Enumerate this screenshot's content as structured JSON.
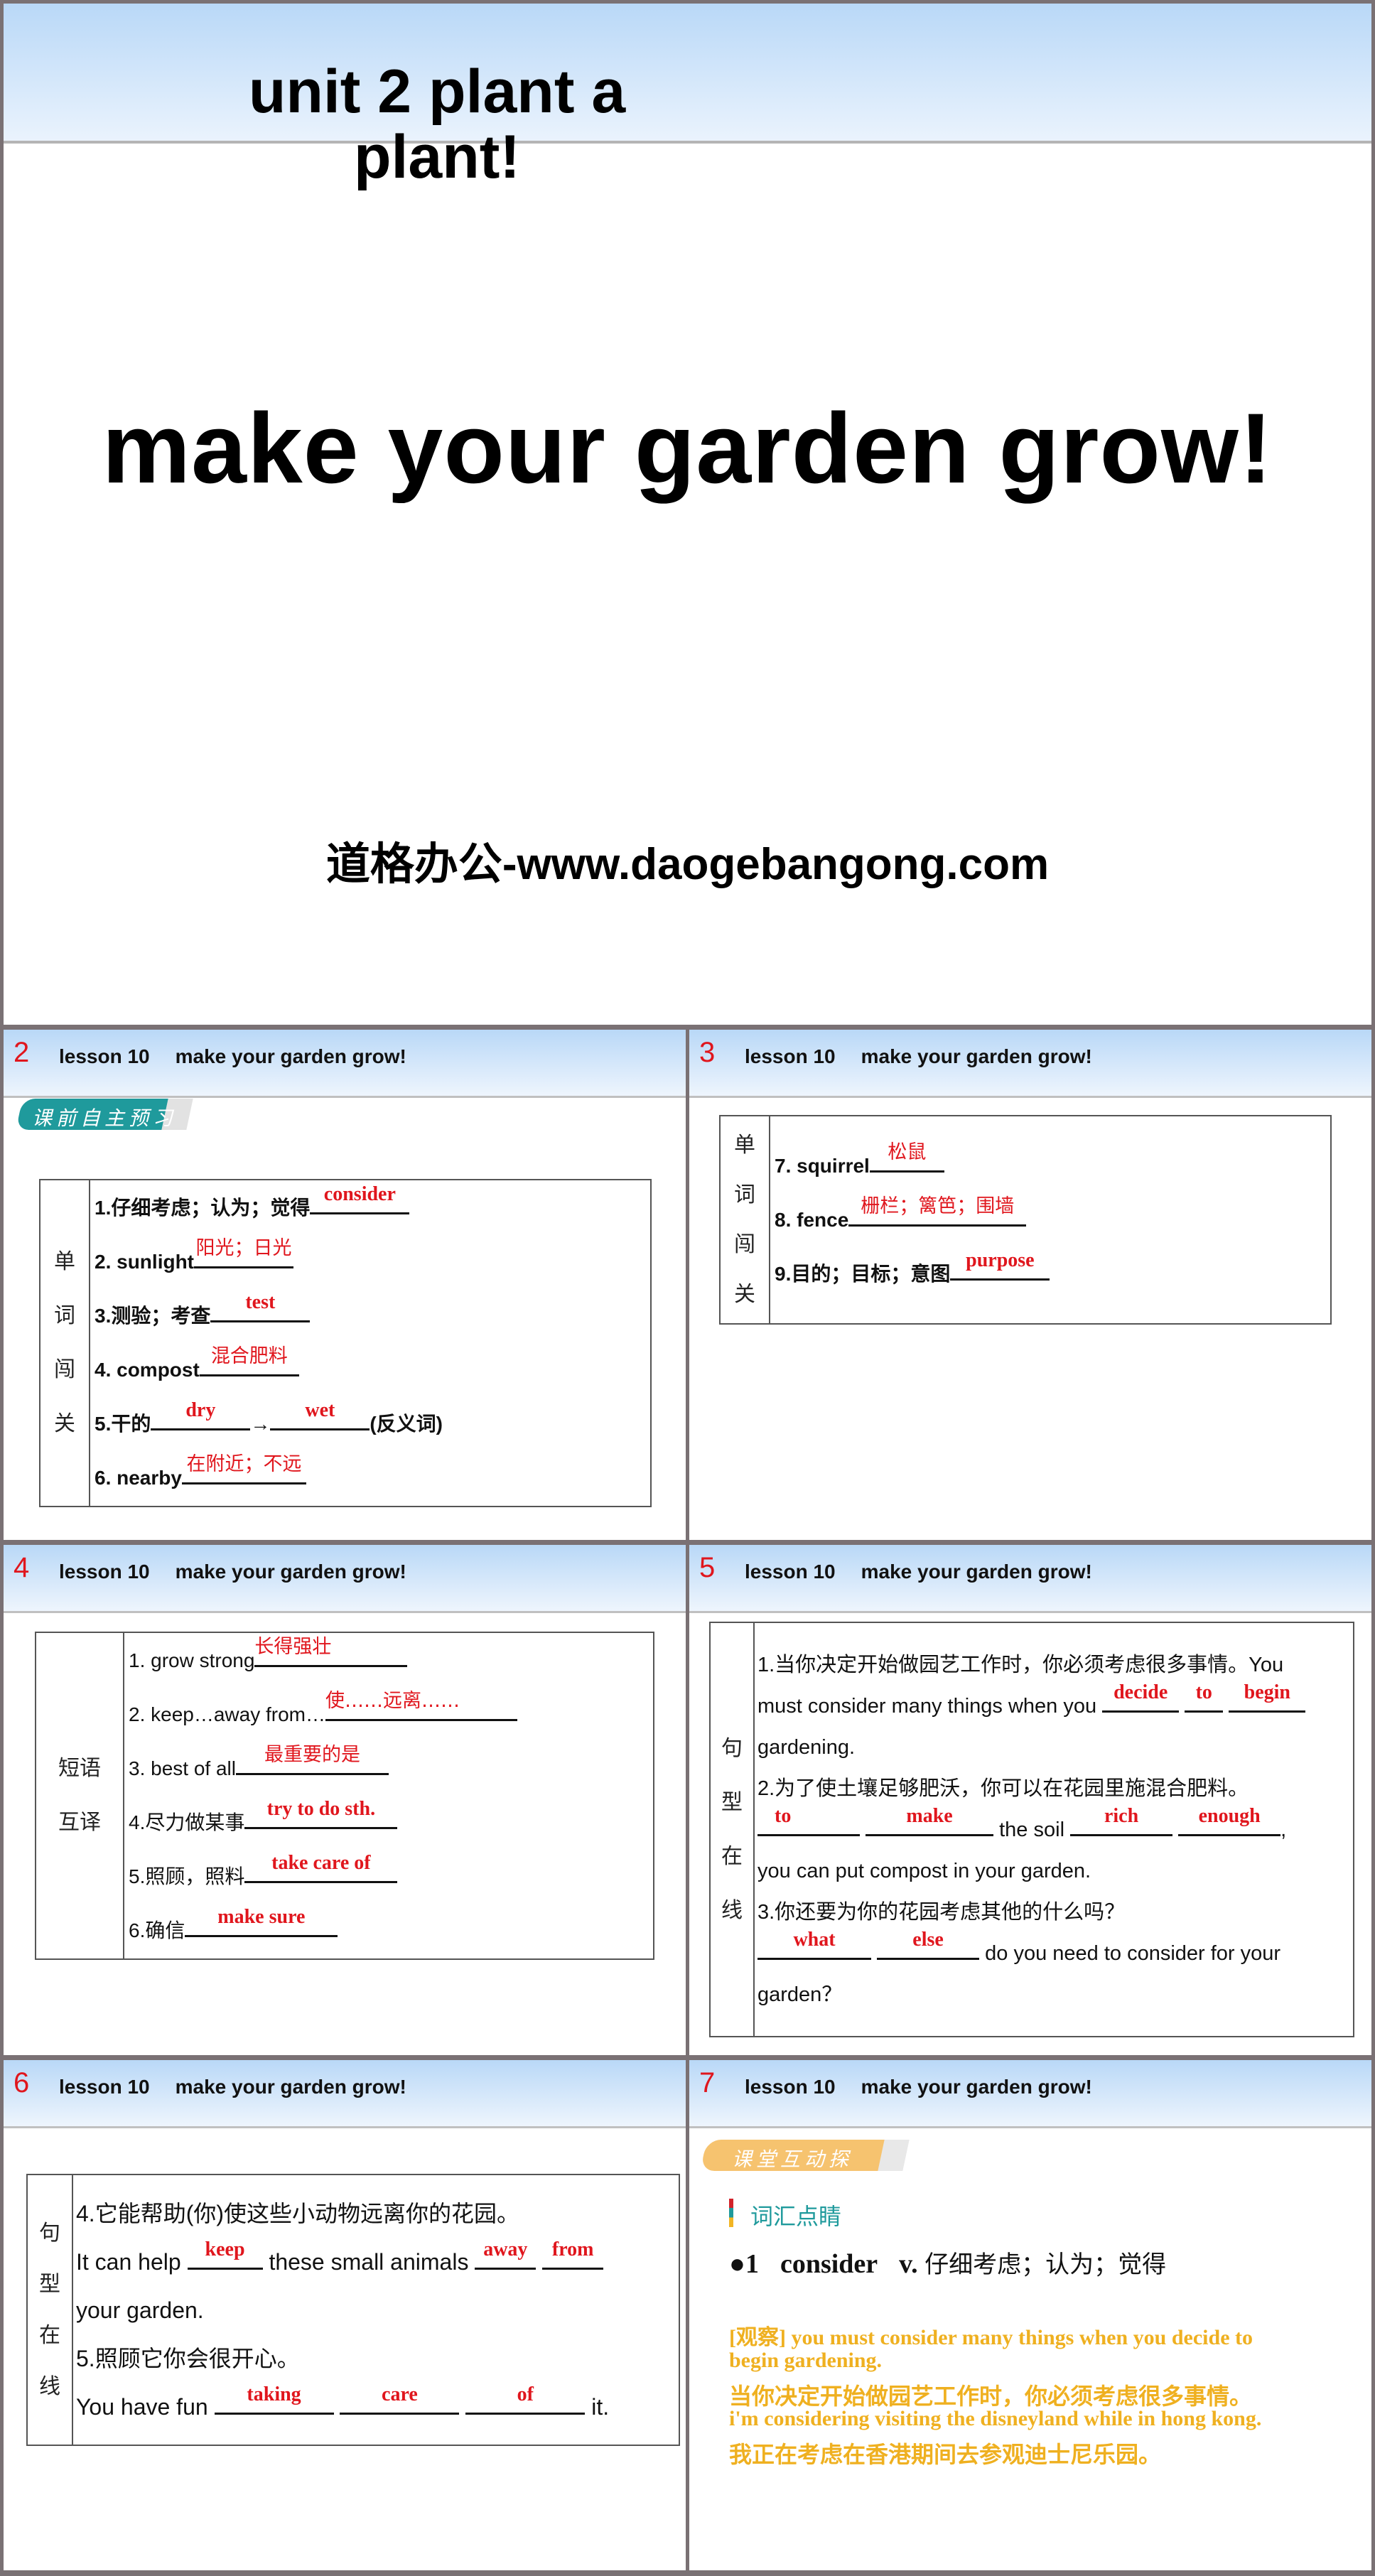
{
  "slide1": {
    "unit_title": "unit 2  plant a plant!",
    "main_title": "make your garden grow!",
    "watermark": "道格办公-www.daogebangong.com"
  },
  "header": {
    "lesson": "lesson 10",
    "title": "make your garden grow!"
  },
  "colors": {
    "answer": "#e0161d",
    "teal": "#1f9a9c",
    "orange": "#efb020",
    "border": "#7a7174"
  },
  "slide2": {
    "number": "2",
    "tag": "课前自主预习",
    "side_label": [
      "单",
      "词",
      "闯",
      "关"
    ],
    "items": [
      {
        "prefix": "1.仔细考虑；认为；觉得",
        "answer": "consider"
      },
      {
        "prefix": "2. sunlight",
        "answer": "阳光；日光"
      },
      {
        "prefix": "3.测验；考查",
        "answer": "test"
      },
      {
        "prefix": "4. compost",
        "answer": "混合肥料"
      },
      {
        "prefix": "5.干的",
        "answer": "dry",
        "arrow": "→",
        "answer2": "wet",
        "suffix": "(反义词)"
      },
      {
        "prefix": "6. nearby",
        "answer": "在附近；不远"
      }
    ]
  },
  "slide3": {
    "number": "3",
    "side_label": [
      "单",
      "词",
      "闯",
      "关"
    ],
    "items": [
      {
        "prefix": "7. squirrel",
        "answer": "松鼠"
      },
      {
        "prefix": "8. fence",
        "answer": "栅栏；篱笆；围墙"
      },
      {
        "prefix": "9.目的；目标；意图",
        "answer": "purpose"
      }
    ]
  },
  "slide4": {
    "number": "4",
    "side_label": [
      "短语",
      "互译"
    ],
    "items": [
      {
        "prefix": "1.   grow strong",
        "answer": "长得强壮"
      },
      {
        "prefix": "2.   keep…away from…",
        "answer": "使……远离……"
      },
      {
        "prefix": "3. best of all",
        "answer": "最重要的是"
      },
      {
        "prefix": "4.尽力做某事",
        "answer": "try to do sth."
      },
      {
        "prefix": "5.照顾，照料",
        "answer": "take care of"
      },
      {
        "prefix": "6.确信",
        "answer": "make sure"
      }
    ]
  },
  "slide5": {
    "number": "5",
    "side_label": [
      "句",
      "型",
      "在",
      "线"
    ],
    "q1_cn": "1.当你决定开始做园艺工作时，你必须考虑很多事情。You",
    "q1_en_pre": "must consider many things when you",
    "q1_answers": [
      "decide",
      "to",
      "begin"
    ],
    "q1_en_post": "gardening.",
    "q2_cn": "2.为了使土壤足够肥沃，你可以在花园里施混合肥料。",
    "q2_answers_a": [
      "to",
      "make"
    ],
    "q2_mid": "the soil",
    "q2_answers_b": [
      "rich",
      "enough"
    ],
    "q2_comma": ",",
    "q2_en_post": "you can put compost in your garden.",
    "q3_cn": "3.你还要为你的花园考虑其他的什么吗？",
    "q3_answers": [
      "what",
      "else"
    ],
    "q3_en_mid": "do you need to consider for your",
    "q3_en_post": "garden？"
  },
  "slide6": {
    "number": "6",
    "side_label": [
      "句",
      "型",
      "在",
      "线"
    ],
    "q4_cn": "4.它能帮助(你)使这些小动物远离你的花园。",
    "q4_pre": "It can help",
    "q4_a1": "keep",
    "q4_mid": "these small animals",
    "q4_a2": [
      "away",
      "from"
    ],
    "q4_post": "your garden.",
    "q5_cn": "5.照顾它你会很开心。",
    "q5_pre": "You have fun",
    "q5_answers": [
      "taking",
      "care",
      "of"
    ],
    "q5_post": "it."
  },
  "slide7": {
    "number": "7",
    "tag": "课堂互动探究",
    "section": "词汇点睛",
    "entry_num": "●1",
    "entry_word": "consider",
    "entry_pos": "v.",
    "entry_def": "仔细考虑；认为；觉得",
    "examples": [
      "[观察] you must consider many things when you decide to",
      "begin gardening.",
      "当你决定开始做园艺工作时，你必须考虑很多事情。",
      "i'm considering visiting the disneyland while in hong kong.",
      "我正在考虑在香港期间去参观迪士尼乐园。"
    ]
  }
}
